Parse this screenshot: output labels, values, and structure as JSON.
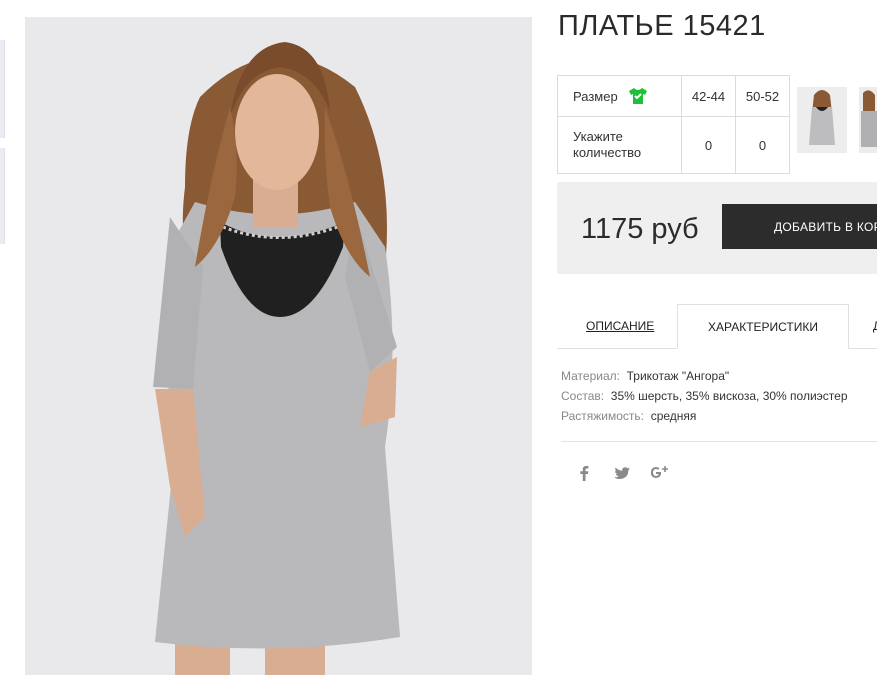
{
  "product": {
    "title": "ПЛАТЬЕ 15421",
    "price": "1175 руб",
    "add_to_cart": "ДОБАВИТЬ В КОРЗИНУ"
  },
  "size_table": {
    "size_label": "Размер",
    "qty_label_1": "Укажите",
    "qty_label_2": "количество",
    "sizes": [
      "42-44",
      "50-52"
    ],
    "quantities": [
      "0",
      "0"
    ]
  },
  "tabs": {
    "description": "ОПИСАНИЕ",
    "characteristics": "ХАРАКТЕРИСТИКИ",
    "more": "Д"
  },
  "specs": [
    {
      "key": "Материал:",
      "value": "Трикотаж \"Ангора\""
    },
    {
      "key": "Состав:",
      "value": "35% шерсть, 35% вискоза, 30% полиэстер"
    },
    {
      "key": "Растяжимость:",
      "value": "средняя"
    }
  ],
  "social": [
    "facebook-icon",
    "twitter-icon",
    "google-plus-icon"
  ],
  "colors": {
    "accent_green": "#1fbf3a",
    "button_bg": "#2c2c2c",
    "buy_bar_bg": "#efefef"
  }
}
